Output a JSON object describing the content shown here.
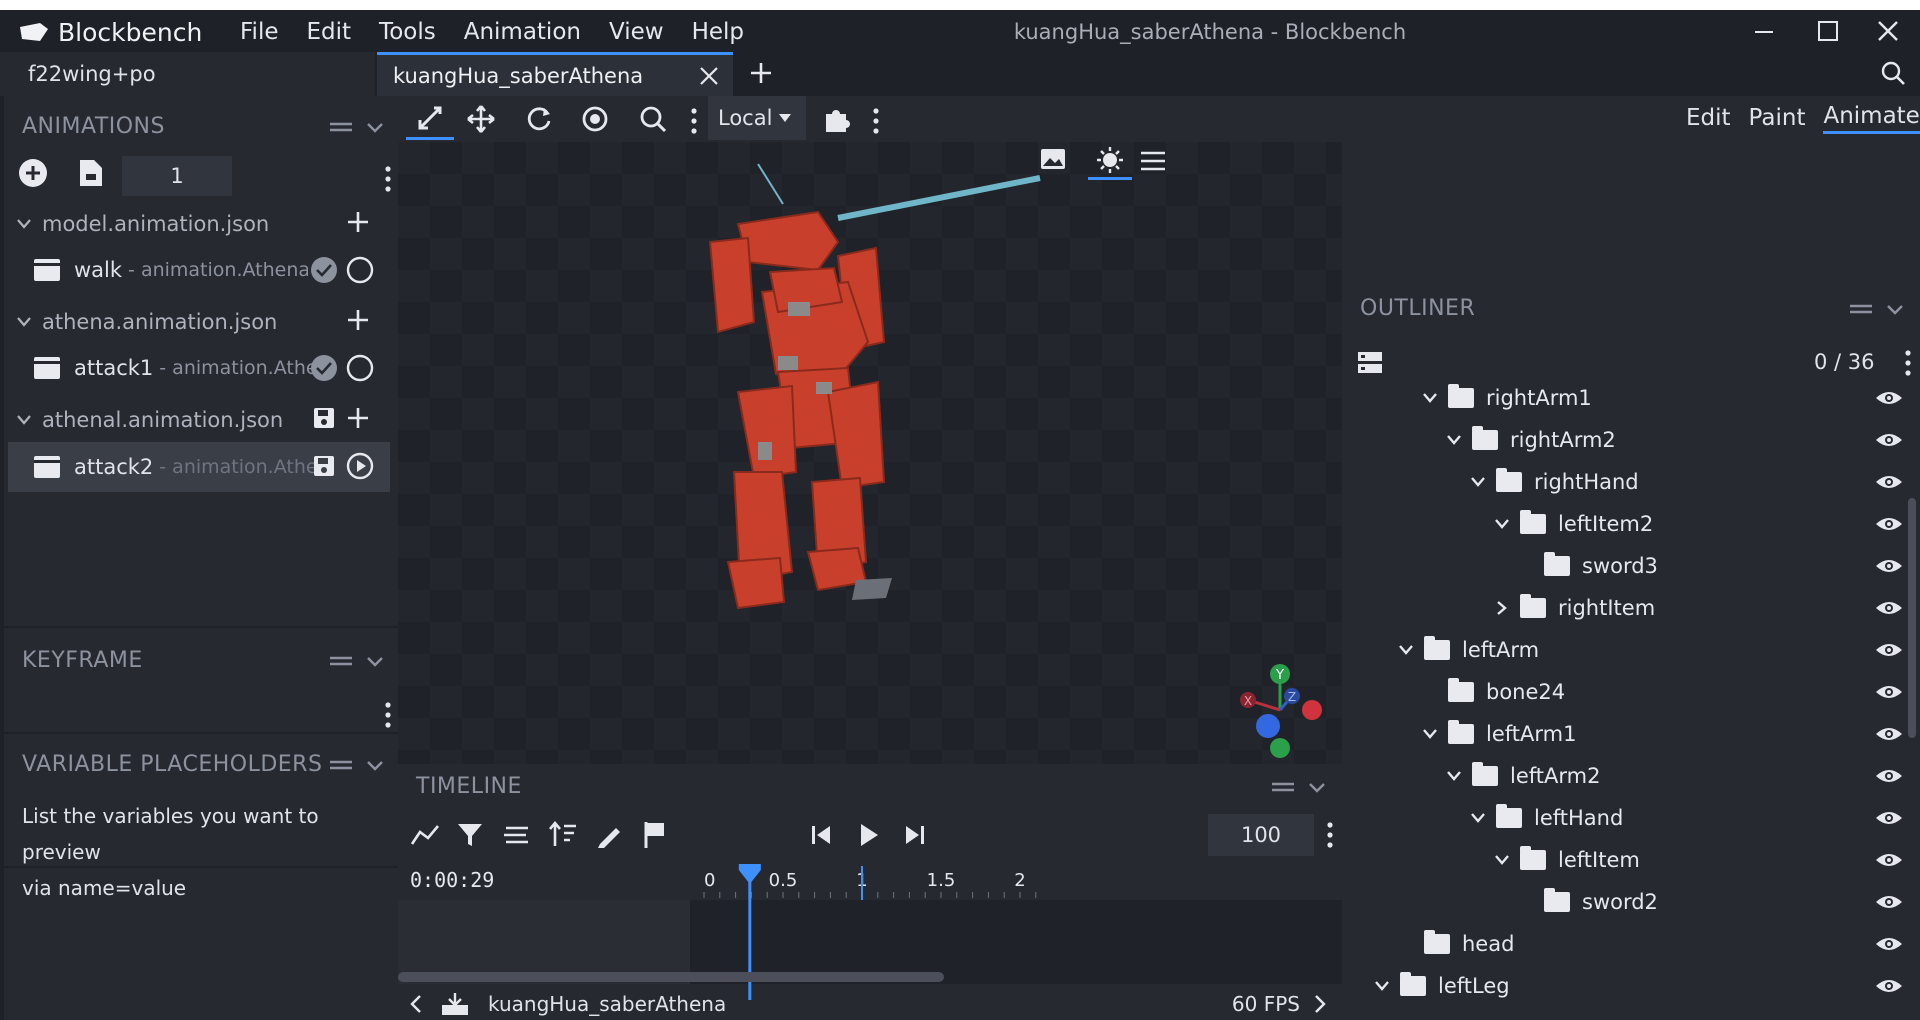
{
  "app": {
    "name": "Blockbench",
    "window_title": "kuangHua_saberAthena - Blockbench"
  },
  "menu": [
    "File",
    "Edit",
    "Tools",
    "Animation",
    "View",
    "Help"
  ],
  "tabs": [
    {
      "label": "f22wing+po"
    },
    {
      "label": "kuangHua_saberAthena"
    }
  ],
  "toolbar": {
    "space_select": "Local"
  },
  "modes": [
    "Edit",
    "Paint",
    "Animate"
  ],
  "animations_panel": {
    "title": "ANIMATIONS",
    "counter_value": "1",
    "files": [
      {
        "name": "model.animation.json",
        "animations": [
          {
            "name": "walk",
            "id": "- animation.Athena.v"
          }
        ]
      },
      {
        "name": "athena.animation.json",
        "animations": [
          {
            "name": "attack1",
            "id": "- animation.Athen"
          }
        ]
      },
      {
        "name": "athenal.animation.json",
        "animations": [
          {
            "name": "attack2",
            "id": "- animation.Athen"
          }
        ]
      }
    ]
  },
  "keyframe_panel": {
    "title": "KEYFRAME"
  },
  "variables_panel": {
    "title": "VARIABLE PLACEHOLDERS",
    "text": "List the variables you want to preview",
    "text2": "via name=value"
  },
  "outliner": {
    "title": "OUTLINER",
    "count": "0 / 36",
    "items": [
      {
        "name": "rightArm1",
        "expanded": true
      },
      {
        "name": "rightArm2",
        "expanded": true
      },
      {
        "name": "rightHand",
        "expanded": true
      },
      {
        "name": "leftItem2",
        "expanded": true
      },
      {
        "name": "sword3",
        "expanded": null
      },
      {
        "name": "rightItem",
        "expanded": false
      },
      {
        "name": "leftArm",
        "expanded": true
      },
      {
        "name": "bone24",
        "expanded": null
      },
      {
        "name": "leftArm1",
        "expanded": true
      },
      {
        "name": "leftArm2",
        "expanded": true
      },
      {
        "name": "leftHand",
        "expanded": true
      },
      {
        "name": "leftItem",
        "expanded": true
      },
      {
        "name": "sword2",
        "expanded": null
      },
      {
        "name": "head",
        "expanded": null
      },
      {
        "name": "leftLeg",
        "expanded": true
      }
    ]
  },
  "timeline": {
    "title": "TIMELINE",
    "time": "0:00:29",
    "zoom_value": "100",
    "ticks": [
      "0",
      "0.5",
      "1",
      "1.5",
      "2"
    ],
    "playhead_seconds": 0.29,
    "model_name": "kuangHua_saberAthena",
    "fps": "60 FPS"
  },
  "gizmo": {
    "x": "X",
    "y": "Y",
    "z": "Z"
  },
  "colors": {
    "accent": "#3e90ff",
    "model_red": "#c8402c",
    "blade": "#6fb6c8"
  }
}
